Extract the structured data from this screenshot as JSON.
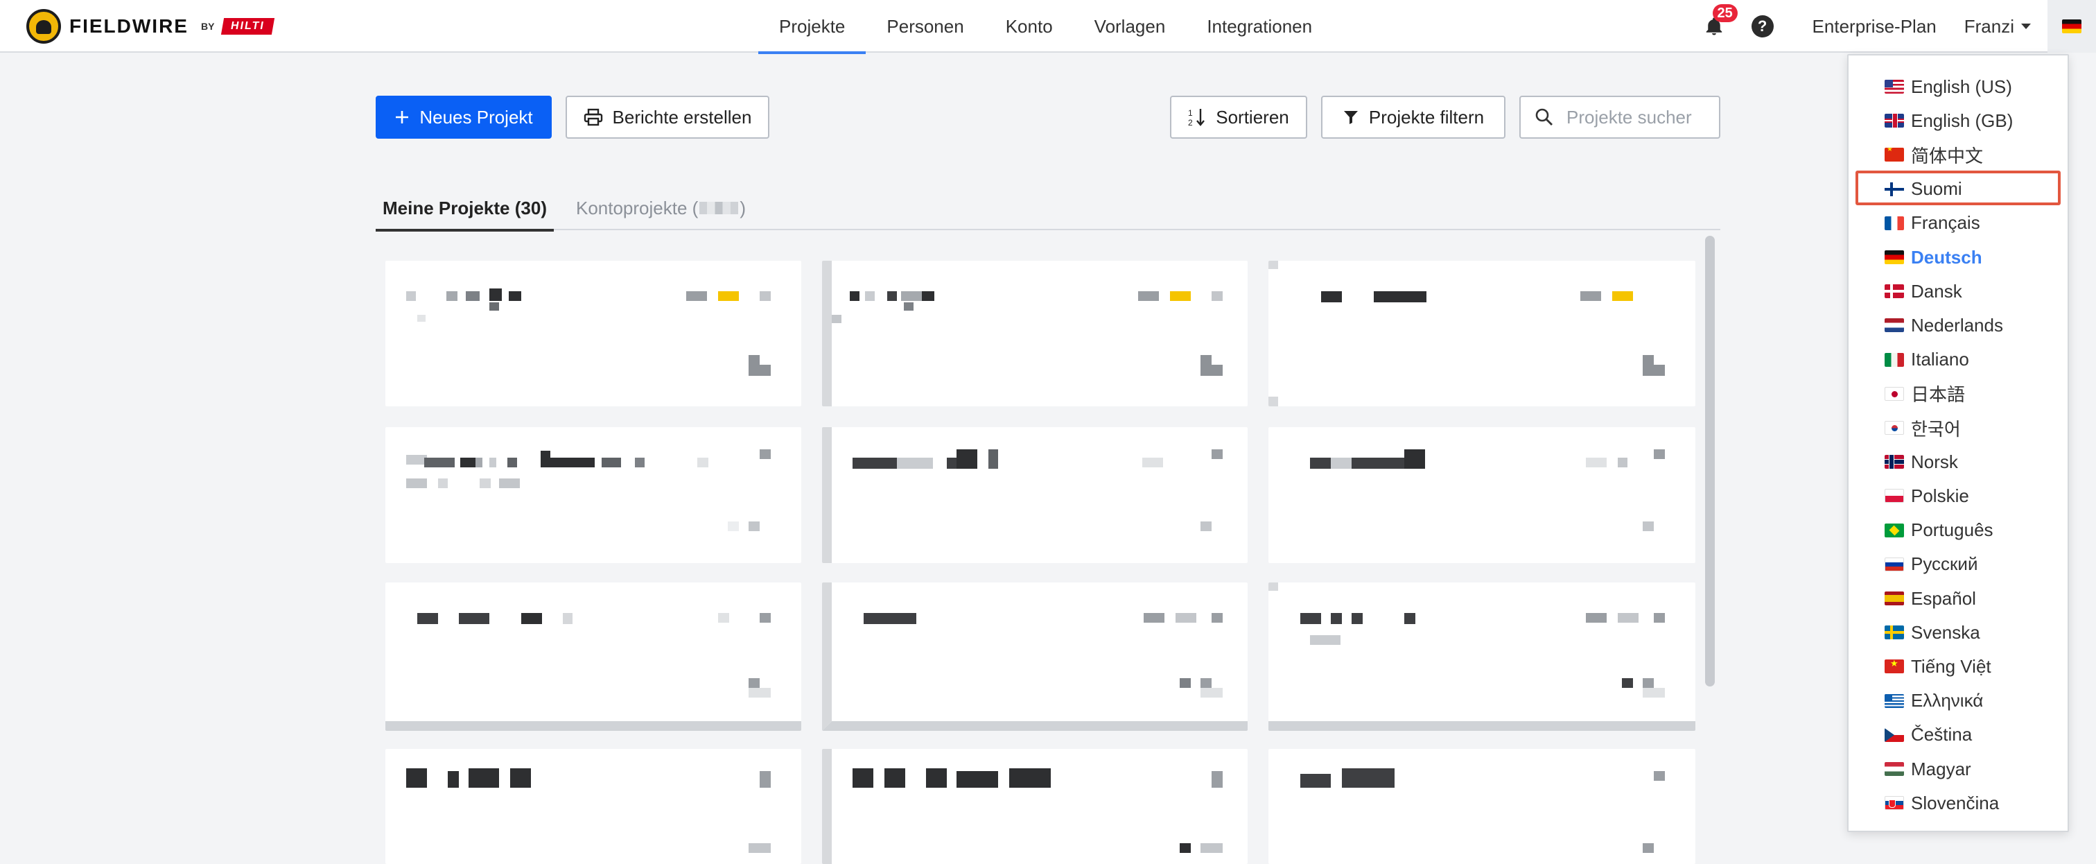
{
  "app": {
    "logo_word": "FIELDWIRE",
    "logo_by": "BY",
    "logo_brand": "HILTI"
  },
  "nav": {
    "items": [
      "Projekte",
      "Personen",
      "Konto",
      "Vorlagen",
      "Integrationen"
    ],
    "active": "Projekte"
  },
  "header_right": {
    "notification_count": "25",
    "help_symbol": "?",
    "plan": "Enterprise-Plan",
    "user": "Franzi"
  },
  "toolbar": {
    "new_project_label": "Neues Projekt",
    "reports_label": "Berichte erstellen",
    "sort_label": "Sortieren",
    "filter_label": "Projekte filtern",
    "search_placeholder": "Projekte sucher"
  },
  "tabs": {
    "my_projects": "Meine Projekte (30)",
    "account_projects_prefix": "Kontoprojekte (",
    "account_projects_suffix": ")"
  },
  "language_menu": {
    "items": [
      {
        "label": "English (US)",
        "flag": "us"
      },
      {
        "label": "English (GB)",
        "flag": "gb"
      },
      {
        "label": "简体中文",
        "flag": "cn"
      },
      {
        "label": "Suomi",
        "flag": "fi"
      },
      {
        "label": "Français",
        "flag": "fr"
      },
      {
        "label": "Deutsch",
        "flag": "de"
      },
      {
        "label": "Dansk",
        "flag": "dk"
      },
      {
        "label": "Nederlands",
        "flag": "nl"
      },
      {
        "label": "Italiano",
        "flag": "it"
      },
      {
        "label": "日本語",
        "flag": "jp"
      },
      {
        "label": "한국어",
        "flag": "kr"
      },
      {
        "label": "Norsk",
        "flag": "no"
      },
      {
        "label": "Polskie",
        "flag": "pl"
      },
      {
        "label": "Português",
        "flag": "br"
      },
      {
        "label": "Русский",
        "flag": "ru"
      },
      {
        "label": "Español",
        "flag": "es"
      },
      {
        "label": "Svenska",
        "flag": "se"
      },
      {
        "label": "Tiếng Việt",
        "flag": "vn"
      },
      {
        "label": "Ελληνικά",
        "flag": "gr"
      },
      {
        "label": "Čeština",
        "flag": "cz"
      },
      {
        "label": "Magyar",
        "flag": "hu"
      },
      {
        "label": "Slovenčina",
        "flag": "sk"
      }
    ],
    "selected": "Deutsch",
    "highlighted": "Suomi"
  },
  "colors": {
    "accent": "#0a60f5",
    "active_nav": "#3a80f3",
    "badge": "#e8253a",
    "highlight_box": "#e2573f",
    "tag_yellow": "#f5c400"
  }
}
